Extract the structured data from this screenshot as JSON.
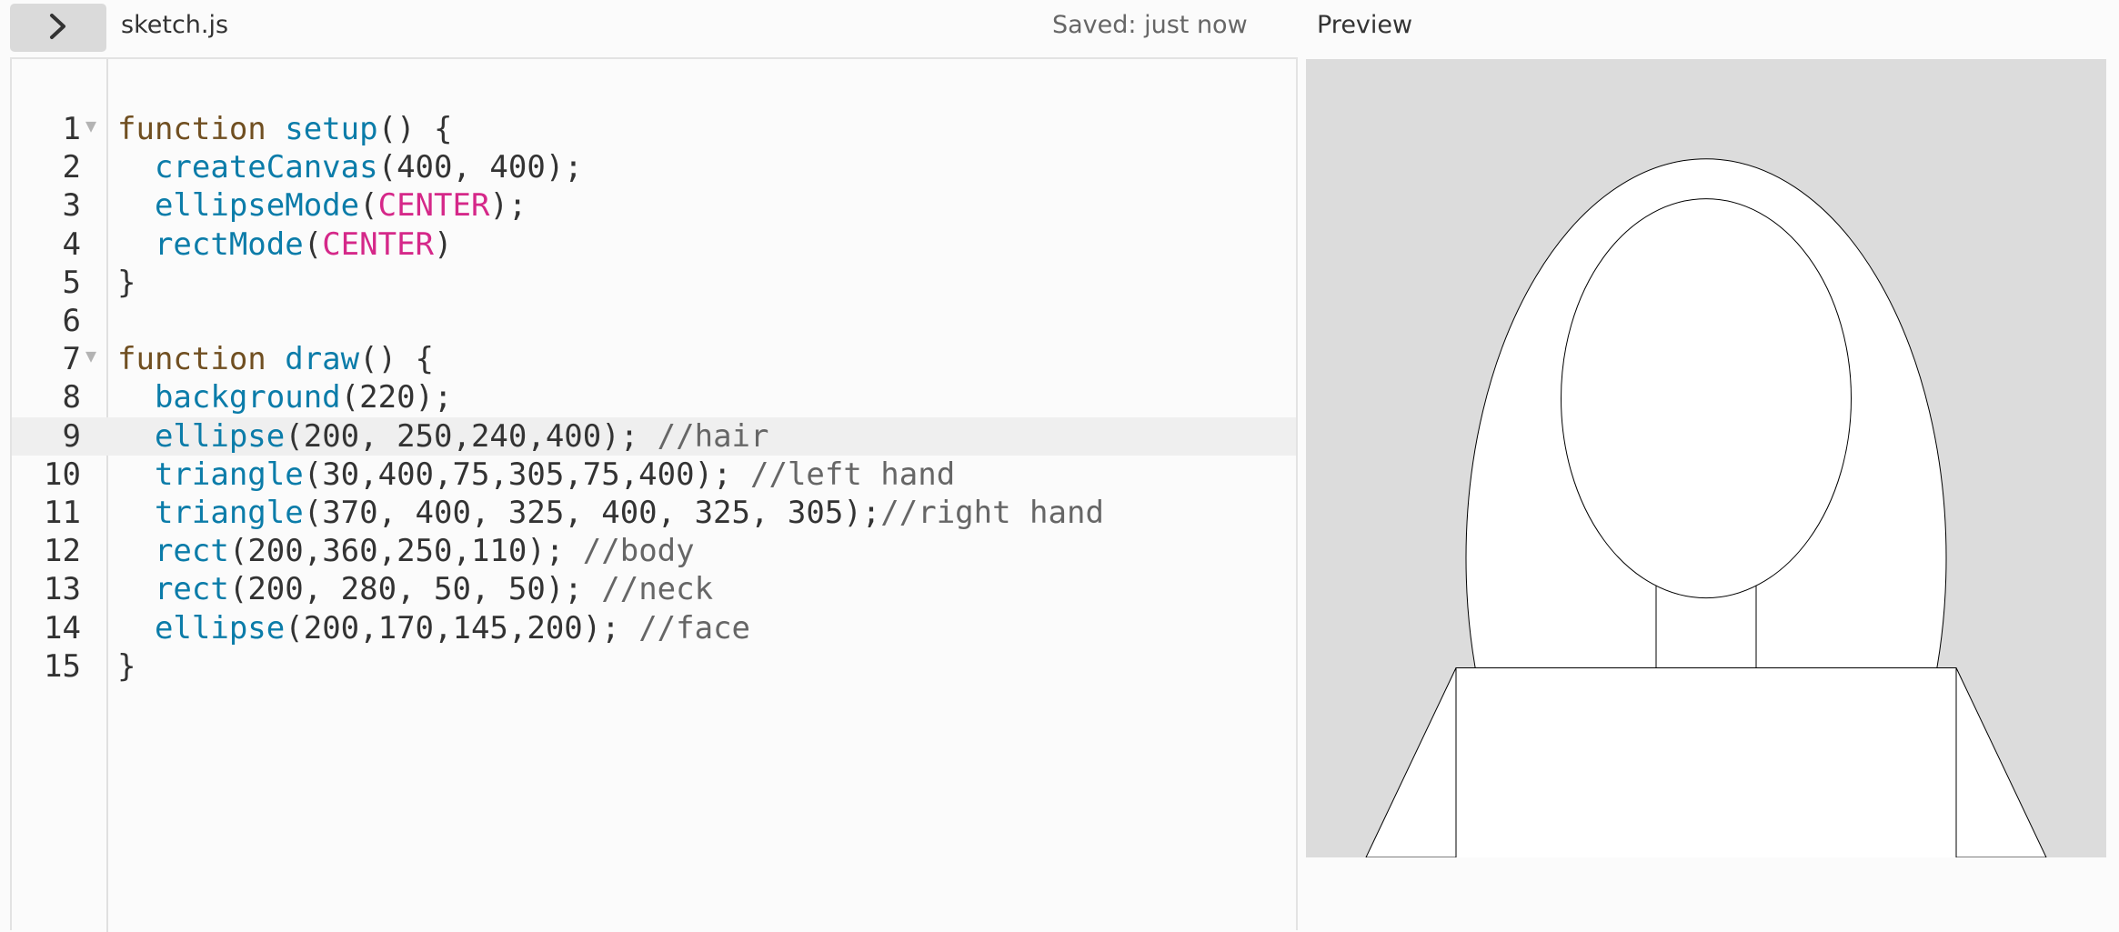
{
  "header": {
    "file_name": "sketch.js",
    "save_status": "Saved: just now",
    "preview_title": "Preview",
    "toggle_icon": "chevron-right-icon"
  },
  "editor": {
    "active_line": 9,
    "lines": [
      {
        "n": "1",
        "fold": true,
        "tokens": [
          [
            "kw",
            "function "
          ],
          [
            "fn",
            "setup"
          ],
          [
            "pn",
            "() {"
          ]
        ]
      },
      {
        "n": "2",
        "fold": false,
        "tokens": [
          [
            "pn",
            "  "
          ],
          [
            "fn",
            "createCanvas"
          ],
          [
            "pn",
            "(400, 400);"
          ]
        ]
      },
      {
        "n": "3",
        "fold": false,
        "tokens": [
          [
            "pn",
            "  "
          ],
          [
            "fn",
            "ellipseMode"
          ],
          [
            "pn",
            "("
          ],
          [
            "cst",
            "CENTER"
          ],
          [
            "pn",
            ");"
          ]
        ]
      },
      {
        "n": "4",
        "fold": false,
        "tokens": [
          [
            "pn",
            "  "
          ],
          [
            "fn",
            "rectMode"
          ],
          [
            "pn",
            "("
          ],
          [
            "cst",
            "CENTER"
          ],
          [
            "pn",
            ")"
          ]
        ]
      },
      {
        "n": "5",
        "fold": false,
        "tokens": [
          [
            "pn",
            "}"
          ]
        ]
      },
      {
        "n": "6",
        "fold": false,
        "tokens": []
      },
      {
        "n": "7",
        "fold": true,
        "tokens": [
          [
            "kw",
            "function "
          ],
          [
            "fn",
            "draw"
          ],
          [
            "pn",
            "() {"
          ]
        ]
      },
      {
        "n": "8",
        "fold": false,
        "tokens": [
          [
            "pn",
            "  "
          ],
          [
            "fn",
            "background"
          ],
          [
            "pn",
            "(220);"
          ]
        ]
      },
      {
        "n": "9",
        "fold": false,
        "tokens": [
          [
            "pn",
            "  "
          ],
          [
            "fn",
            "ellipse"
          ],
          [
            "pn",
            "(200, 250,240,400); "
          ],
          [
            "cm",
            "//hair"
          ]
        ]
      },
      {
        "n": "10",
        "fold": false,
        "tokens": [
          [
            "pn",
            "  "
          ],
          [
            "fn",
            "triangle"
          ],
          [
            "pn",
            "(30,400,75,305,75,400); "
          ],
          [
            "cm",
            "//left hand"
          ]
        ]
      },
      {
        "n": "11",
        "fold": false,
        "tokens": [
          [
            "pn",
            "  "
          ],
          [
            "fn",
            "triangle"
          ],
          [
            "pn",
            "(370, 400, 325, 400, 325, 305);"
          ],
          [
            "cm",
            "//right hand"
          ]
        ]
      },
      {
        "n": "12",
        "fold": false,
        "tokens": [
          [
            "pn",
            "  "
          ],
          [
            "fn",
            "rect"
          ],
          [
            "pn",
            "(200,360,250,110); "
          ],
          [
            "cm",
            "//body"
          ]
        ]
      },
      {
        "n": "13",
        "fold": false,
        "tokens": [
          [
            "pn",
            "  "
          ],
          [
            "fn",
            "rect"
          ],
          [
            "pn",
            "(200, 280, 50, 50); "
          ],
          [
            "cm",
            "//neck"
          ]
        ]
      },
      {
        "n": "14",
        "fold": false,
        "tokens": [
          [
            "pn",
            "  "
          ],
          [
            "fn",
            "ellipse"
          ],
          [
            "pn",
            "(200,170,145,200); "
          ],
          [
            "cm",
            "//face"
          ]
        ]
      },
      {
        "n": "15",
        "fold": false,
        "tokens": [
          [
            "pn",
            "}"
          ]
        ]
      }
    ]
  },
  "colors": {
    "keyword": "#704f21",
    "function": "#0b7ca9",
    "constant": "#d52889",
    "comment": "#666666",
    "canvas_background": "#dcdcdc"
  },
  "preview": {
    "canvas_size": [
      400,
      400
    ],
    "background": 220,
    "shapes": [
      {
        "name": "hair",
        "type": "ellipse",
        "args": [
          200,
          250,
          240,
          400
        ]
      },
      {
        "name": "left-hand",
        "type": "triangle",
        "args": [
          30,
          400,
          75,
          305,
          75,
          400
        ]
      },
      {
        "name": "right-hand",
        "type": "triangle",
        "args": [
          370,
          400,
          325,
          400,
          325,
          305
        ]
      },
      {
        "name": "body",
        "type": "rect",
        "args": [
          200,
          360,
          250,
          110
        ]
      },
      {
        "name": "neck",
        "type": "rect",
        "args": [
          200,
          280,
          50,
          50
        ]
      },
      {
        "name": "face",
        "type": "ellipse",
        "args": [
          200,
          170,
          145,
          200
        ]
      }
    ]
  }
}
